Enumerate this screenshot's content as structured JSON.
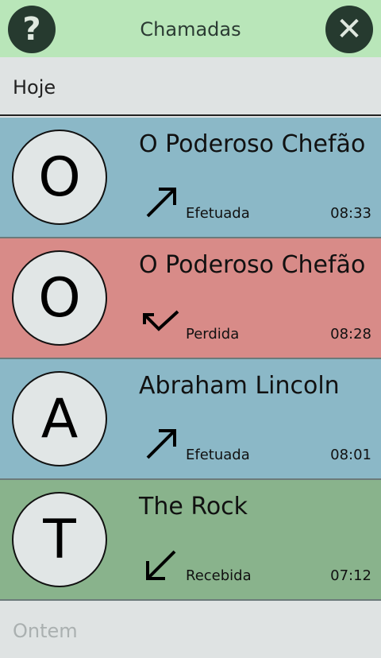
{
  "header": {
    "title": "Chamadas",
    "help_label": "?",
    "close_label": "✕"
  },
  "sections": {
    "today": "Hoje",
    "yesterday": "Ontem"
  },
  "calls": [
    {
      "initial": "O",
      "name": "O Poderoso Chefão",
      "type": "Efetuada",
      "time": "08:33",
      "color": "#8bb8c7",
      "icon": "outgoing-arrow-icon"
    },
    {
      "initial": "O",
      "name": "O Poderoso Chefão",
      "type": "Perdida",
      "time": "08:28",
      "color": "#d88b88",
      "icon": "missed-call-arrow-icon"
    },
    {
      "initial": "A",
      "name": "Abraham Lincoln",
      "type": "Efetuada",
      "time": "08:01",
      "color": "#8bb8c7",
      "icon": "outgoing-arrow-icon"
    },
    {
      "initial": "T",
      "name": "The Rock",
      "type": "Recebida",
      "time": "07:12",
      "color": "#89b38c",
      "icon": "incoming-arrow-icon"
    }
  ]
}
